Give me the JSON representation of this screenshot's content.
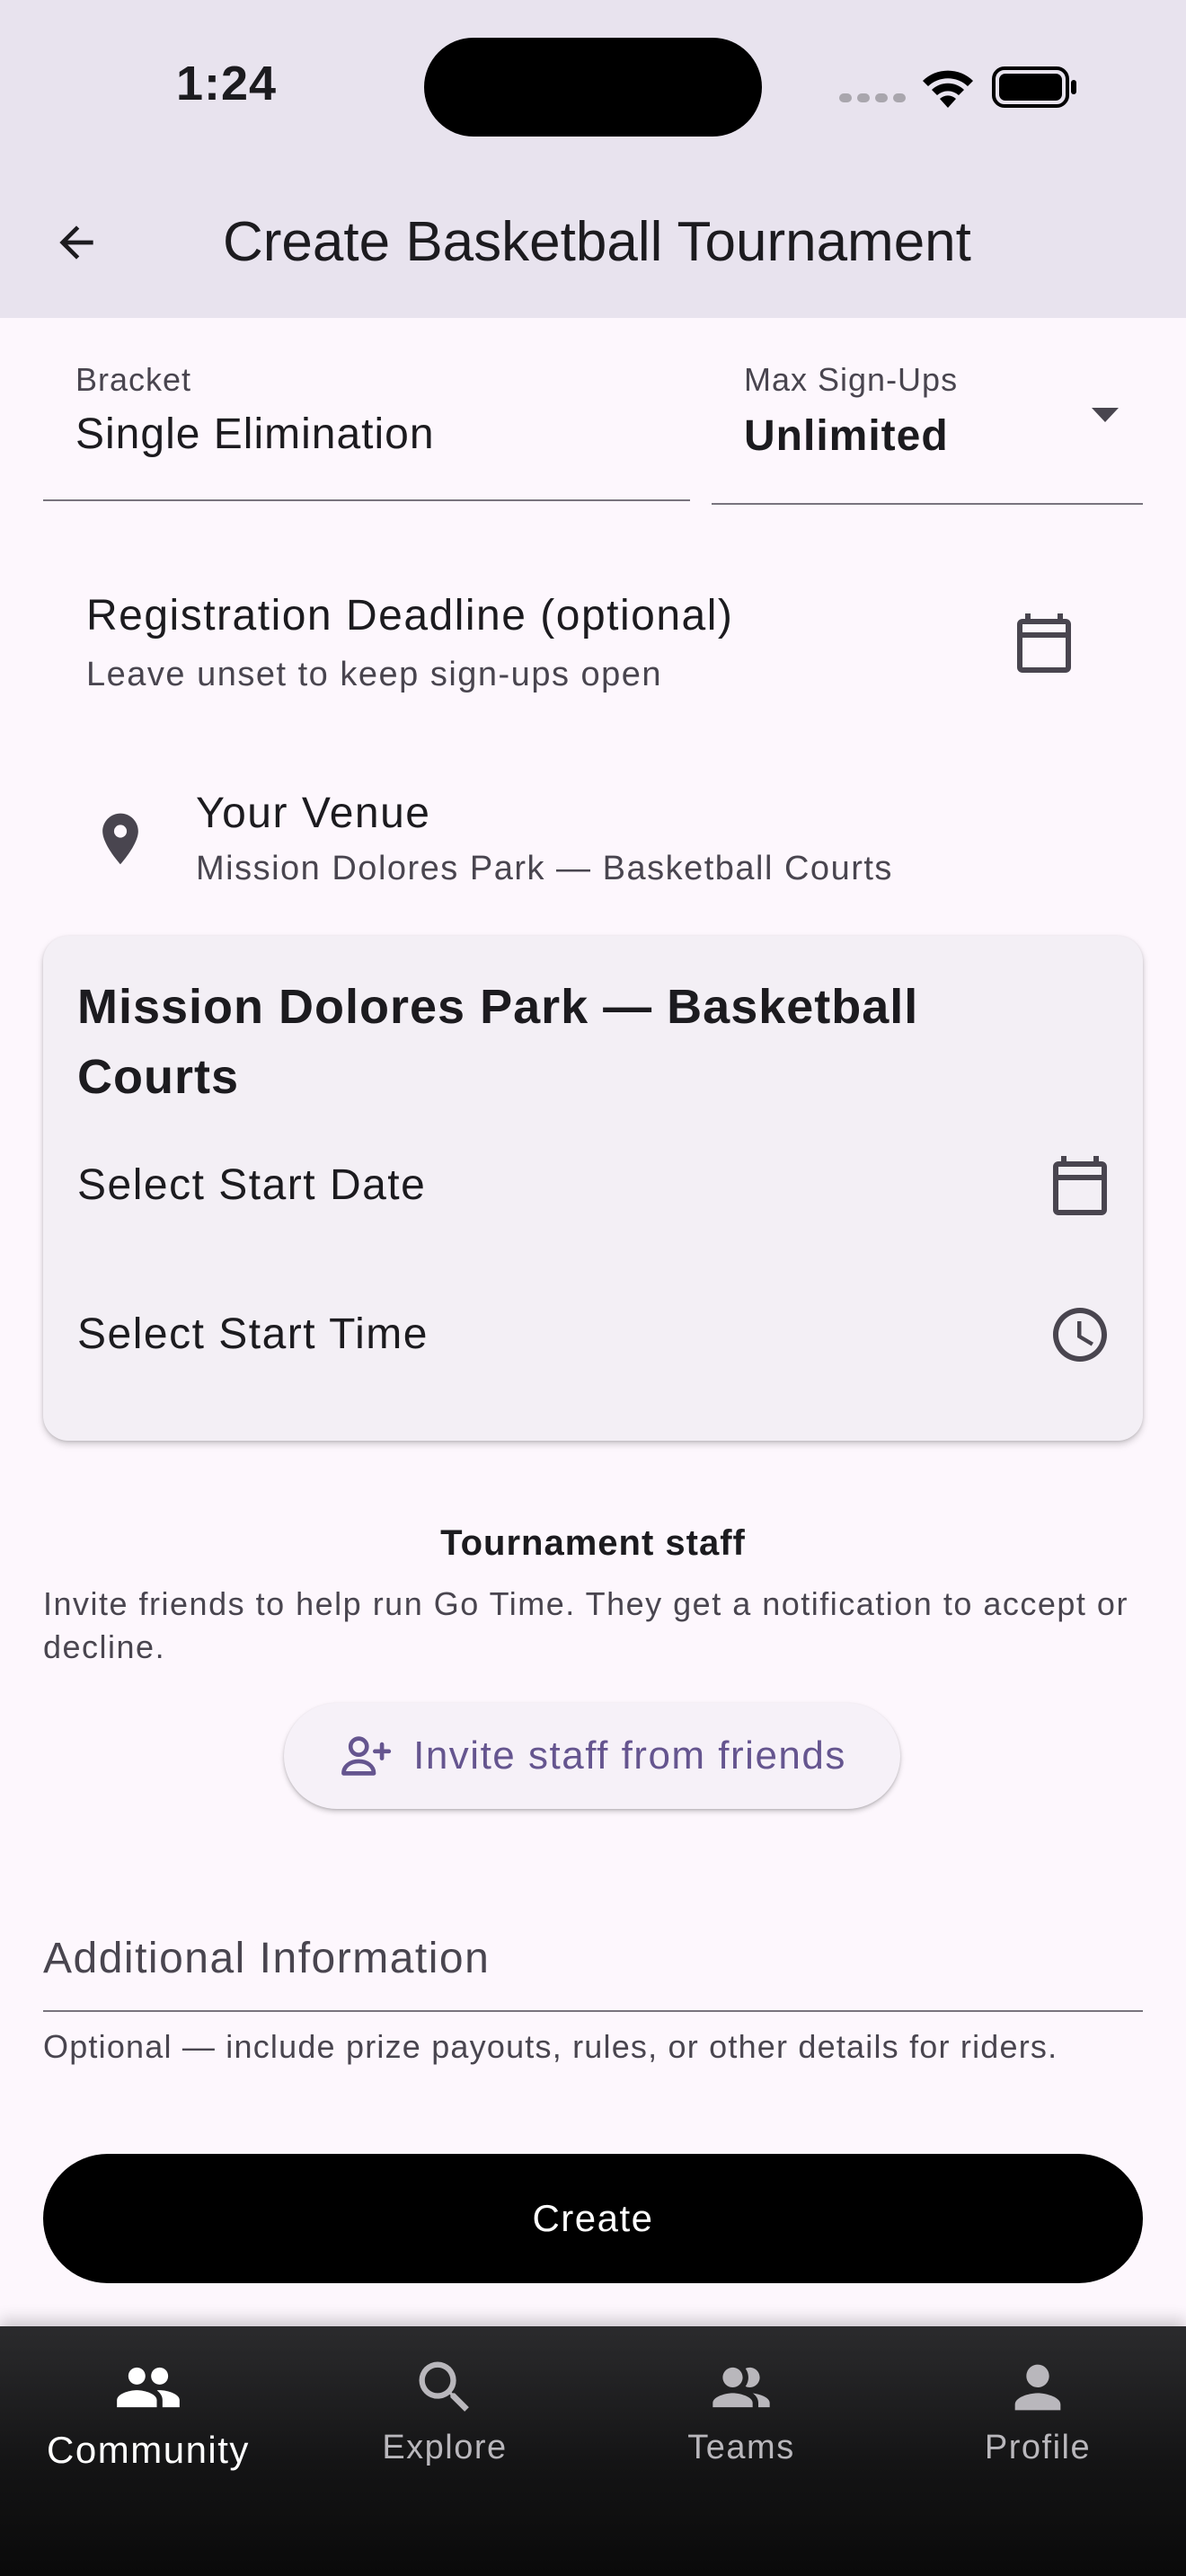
{
  "status_bar": {
    "time": "1:24"
  },
  "app_bar": {
    "title": "Create Basketball Tournament"
  },
  "bracket": {
    "label": "Bracket",
    "value": "Single Elimination"
  },
  "max_signups": {
    "label": "Max Sign-Ups",
    "value": "Unlimited"
  },
  "registration": {
    "title": "Registration Deadline (optional)",
    "subtitle": "Leave unset to keep sign-ups open"
  },
  "venue": {
    "title": "Your Venue",
    "subtitle": "Mission Dolores Park — Basketball Courts"
  },
  "venue_card": {
    "title": "Mission Dolores Park — Basketball Courts",
    "start_date": "Select Start Date",
    "start_time": "Select Start Time"
  },
  "staff": {
    "title": "Tournament staff",
    "description": "Invite friends to help run Go Time. They get a notification to accept or decline.",
    "invite_label": "Invite staff from friends"
  },
  "additional_info": {
    "placeholder": "Additional Information",
    "helper": "Optional — include prize payouts, rules, or other details for riders."
  },
  "create_label": "Create",
  "nav": {
    "items": [
      {
        "label": "Community",
        "icon": "community-icon",
        "active": true
      },
      {
        "label": "Explore",
        "icon": "search-icon",
        "active": false
      },
      {
        "label": "Teams",
        "icon": "teams-icon",
        "active": false
      },
      {
        "label": "Profile",
        "icon": "person-icon",
        "active": false
      }
    ]
  },
  "colors": {
    "accent": "#65558f",
    "app_bar": "#e8e3ee",
    "background": "#fdf7fd"
  }
}
